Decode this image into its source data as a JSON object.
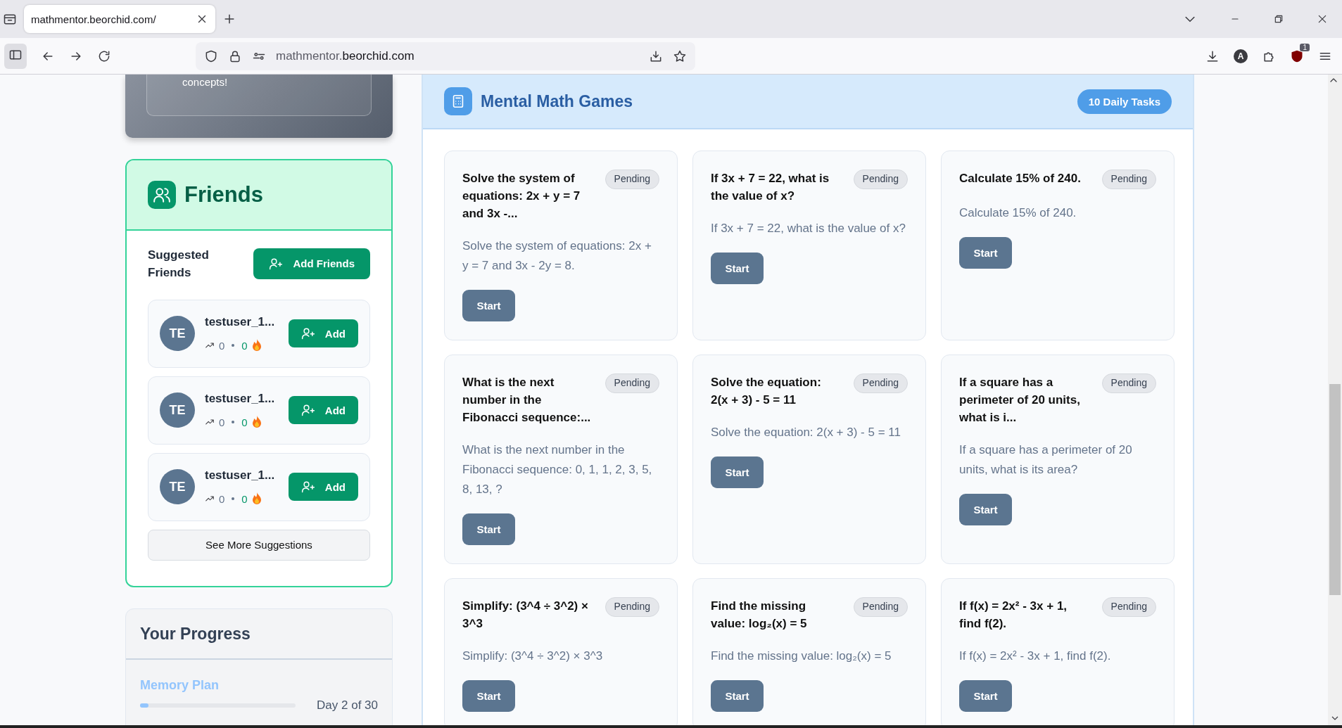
{
  "browser": {
    "tab": {
      "title": "mathmentor.beorchid.com/"
    },
    "address": {
      "host_prefix": "mathmentor.",
      "domain": "beorchid.com"
    },
    "account_letter": "A",
    "extension_badge": "1"
  },
  "intro_card": {
    "text": "concepts!"
  },
  "friends": {
    "title": "Friends",
    "subtitle": "Suggested Friends",
    "add_button": "Add Friends",
    "more_button": "See More Suggestions",
    "suggestions": [
      {
        "initials": "TE",
        "name": "testuser_1...",
        "trend": "0",
        "streak": "0",
        "button": "Add"
      },
      {
        "initials": "TE",
        "name": "testuser_1...",
        "trend": "0",
        "streak": "0",
        "button": "Add"
      },
      {
        "initials": "TE",
        "name": "testuser_1...",
        "trend": "0",
        "streak": "0",
        "button": "Add"
      }
    ]
  },
  "progress": {
    "title": "Your Progress",
    "plan": "Memory Plan",
    "day": "Day 2 of 30",
    "level": 0.03
  },
  "games": {
    "title": "Mental Math Games",
    "badge": "10 Daily Tasks",
    "tasks": [
      {
        "title": "Solve the system of equations: 2x + y = 7 and 3x -...",
        "status": "Pending",
        "description": "Solve the system of equations: 2x + y = 7 and 3x - 2y = 8.",
        "button": "Start"
      },
      {
        "title": "If 3x + 7 = 22, what is the value of x?",
        "status": "Pending",
        "description": "If 3x + 7 = 22, what is the value of x?",
        "button": "Start"
      },
      {
        "title": "Calculate 15% of 240.",
        "status": "Pending",
        "description": "Calculate 15% of 240.",
        "button": "Start"
      },
      {
        "title": "What is the next number in the Fibonacci sequence:...",
        "status": "Pending",
        "description": "What is the next number in the Fibonacci sequence: 0, 1, 1, 2, 3, 5, 8, 13, ?",
        "button": "Start"
      },
      {
        "title": "Solve the equation: 2(x + 3) - 5 = 11",
        "status": "Pending",
        "description": "Solve the equation: 2(x + 3) - 5 = 11",
        "button": "Start"
      },
      {
        "title": "If a square has a perimeter of 20 units, what is i...",
        "status": "Pending",
        "description": "If a square has a perimeter of 20 units, what is its area?",
        "button": "Start"
      },
      {
        "title": "Simplify: (3^4 ÷ 3^2) × 3^3",
        "status": "Pending",
        "description": "Simplify: (3^4 ÷ 3^2) × 3^3",
        "button": "Start"
      },
      {
        "title": "Find the missing value: log₂(x) = 5",
        "status": "Pending",
        "description": "Find the missing value: log₂(x) = 5",
        "button": "Start"
      },
      {
        "title": "If f(x) = 2x² - 3x + 1, find f(2).",
        "status": "Pending",
        "description": "If f(x) = 2x² - 3x + 1, find f(2).",
        "button": "Start"
      }
    ]
  }
}
